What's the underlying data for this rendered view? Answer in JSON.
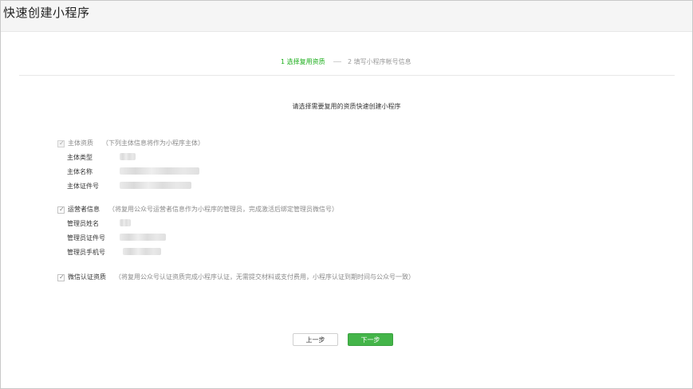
{
  "header": {
    "title": "快速创建小程序"
  },
  "steps": [
    {
      "label": "1 选择复用资质",
      "state": "active"
    },
    {
      "label": "2 填写小程序帐号信息",
      "state": "inactive"
    }
  ],
  "instruction": "请选择需要复用的资质快速创建小程序",
  "sections": {
    "subject": {
      "title": "主体资质",
      "note": "（下列主体信息将作为小程序主体）",
      "checked": true,
      "disabled": true,
      "rows": [
        {
          "label": "主体类型"
        },
        {
          "label": "主体名称"
        },
        {
          "label": "主体证件号"
        }
      ]
    },
    "operator": {
      "title": "运营者信息",
      "note": "（将复用公众号运营者信息作为小程序的管理员，完成激活后绑定管理员微信号）",
      "checked": true,
      "disabled": false,
      "rows": [
        {
          "label": "管理员姓名"
        },
        {
          "label": "管理员证件号"
        },
        {
          "label": "管理员手机号"
        }
      ]
    },
    "wechat_cert": {
      "title": "微信认证资质",
      "note": "（将复用公众号认证资质完成小程序认证，无需提交材料或支付费用，小程序认证到期时间与公众号一致）",
      "checked": true,
      "disabled": false
    }
  },
  "buttons": {
    "prev_label": "上一步",
    "next_label": "下一步"
  },
  "colors": {
    "accent": "#1aad19",
    "primary_button": "#44b549"
  }
}
